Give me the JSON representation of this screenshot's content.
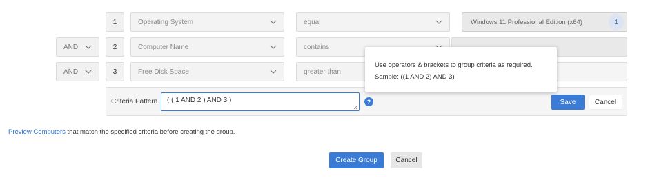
{
  "rows": [
    {
      "num": "1",
      "field": "Operating System",
      "operator": "equal",
      "value": "Windows 11 Professional Edition (x64)",
      "value_count": "1"
    },
    {
      "num": "2",
      "join": "AND",
      "field": "Computer Name",
      "operator": "contains"
    },
    {
      "num": "3",
      "join": "AND",
      "field": "Free Disk Space",
      "operator": "greater than"
    }
  ],
  "criteria": {
    "label": "Criteria Pattern",
    "value": "( ( 1  AND 2 ) AND 3 )",
    "help_glyph": "?",
    "save_label": "Save",
    "cancel_label": "Cancel"
  },
  "tooltip": {
    "line1": "Use operators & brackets to group criteria as required.",
    "line2": "Sample: ((1 AND 2) AND 3)"
  },
  "preview": {
    "link": "Preview Computers",
    "text": " that match the specified criteria before creating the group."
  },
  "footer": {
    "create_label": "Create Group",
    "cancel_label": "Cancel"
  },
  "colors": {
    "accent": "#3a7bd5",
    "field_bg": "#f3f3f3",
    "border": "#dcdcdc"
  }
}
